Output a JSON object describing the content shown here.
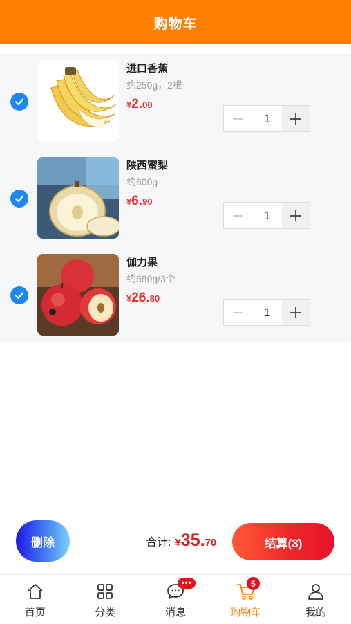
{
  "header": {
    "title": "购物车"
  },
  "cart": {
    "items": [
      {
        "name": "进口香蕉",
        "spec": "约250g，2根",
        "currency": "¥",
        "price_int": "2.",
        "price_dec": "00",
        "quantity": "1",
        "checked": true,
        "image": "banana-image"
      },
      {
        "name": "陕西蜜梨",
        "spec": "约600g",
        "currency": "¥",
        "price_int": "6.",
        "price_dec": "90",
        "quantity": "1",
        "checked": true,
        "image": "pear-image"
      },
      {
        "name": "伽力果",
        "spec": "约680g/3个",
        "currency": "¥",
        "price_int": "26.",
        "price_dec": "80",
        "quantity": "1",
        "checked": true,
        "image": "apple-image"
      }
    ]
  },
  "footer": {
    "delete_label": "删除",
    "total_label": "合计:",
    "total_currency": "¥",
    "total_int": "35.",
    "total_dec": "70",
    "checkout_label": "结算(3)"
  },
  "tabbar": {
    "tabs": [
      {
        "label": "首页",
        "icon": "home-icon"
      },
      {
        "label": "分类",
        "icon": "category-icon"
      },
      {
        "label": "消息",
        "icon": "message-icon",
        "badge": "•••"
      },
      {
        "label": "购物车",
        "icon": "cart-icon",
        "badge": "5",
        "active": true
      },
      {
        "label": "我的",
        "icon": "user-icon"
      }
    ]
  },
  "colors": {
    "brand": "#ff7f00",
    "check": "#1e88f0",
    "price": "#ee2a2a",
    "badge": "#e8121c"
  }
}
